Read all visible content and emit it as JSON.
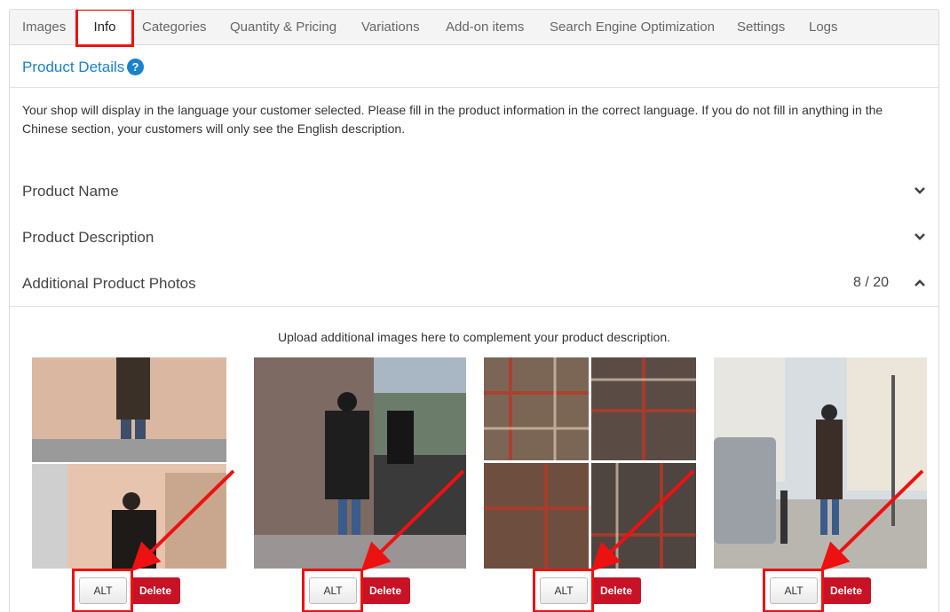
{
  "tabs": [
    {
      "label": "Images"
    },
    {
      "label": "Info"
    },
    {
      "label": "Categories"
    },
    {
      "label": "Quantity & Pricing"
    },
    {
      "label": "Variations"
    },
    {
      "label": "Add-on items"
    },
    {
      "label": "Search Engine Optimization"
    },
    {
      "label": "Settings"
    },
    {
      "label": "Logs"
    }
  ],
  "active_tab": "Info",
  "product_details": {
    "title": "Product Details",
    "help_glyph": "?"
  },
  "notice": "Your shop will display in the language your customer selected. Please fill in the product information in the correct language. If you do not fill in anything in the Chinese section, your customers will only see the English description.",
  "sections": [
    {
      "label": "Product Name",
      "state": "collapsed"
    },
    {
      "label": "Product Description",
      "state": "collapsed"
    },
    {
      "label": "Additional Product Photos",
      "state": "expanded",
      "count": "8 / 20"
    }
  ],
  "upload_hint": "Upload additional images here to complement your product description.",
  "photos": [
    {
      "alt_label": "ALT",
      "delete_label": "Delete"
    },
    {
      "alt_label": "ALT",
      "delete_label": "Delete"
    },
    {
      "alt_label": "ALT",
      "delete_label": "Delete"
    },
    {
      "alt_label": "ALT",
      "delete_label": "Delete"
    }
  ],
  "colors": {
    "accent": "#1a82c8",
    "highlight": "#ee1111",
    "delete": "#c81225"
  },
  "icons": [
    "help-icon",
    "chevron-down-icon",
    "chevron-up-icon",
    "red-arrow-icon"
  ]
}
